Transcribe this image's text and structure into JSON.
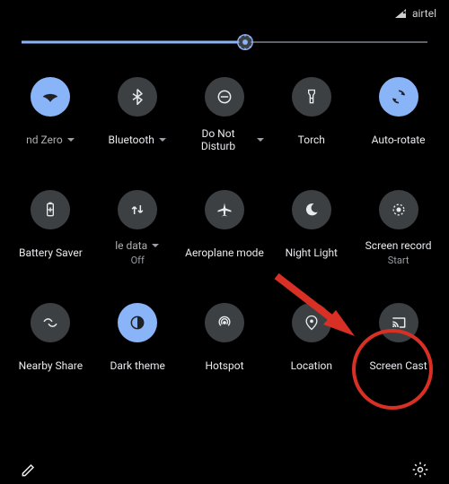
{
  "status": {
    "carrier": "airtel"
  },
  "brightness": {
    "value_pct": 55
  },
  "tiles": {
    "wifi": {
      "label": "nd Zero"
    },
    "bluetooth": {
      "label": "Bluetooth"
    },
    "dnd": {
      "label": "Do Not Disturb"
    },
    "torch": {
      "label": "Torch"
    },
    "autorotate": {
      "label": "Auto-rotate"
    },
    "battery": {
      "label": "Battery Saver"
    },
    "data": {
      "label": "le data",
      "sub": "Off"
    },
    "aeroplane": {
      "label": "Aeroplane mode"
    },
    "nightlight": {
      "label": "Night Light"
    },
    "screenrec": {
      "label": "Screen record",
      "sub": "Start"
    },
    "nearby": {
      "label": "Nearby Share"
    },
    "darktheme": {
      "label": "Dark theme"
    },
    "hotspot": {
      "label": "Hotspot"
    },
    "location": {
      "label": "Location"
    },
    "screencast": {
      "label": "Screen Cast"
    }
  }
}
